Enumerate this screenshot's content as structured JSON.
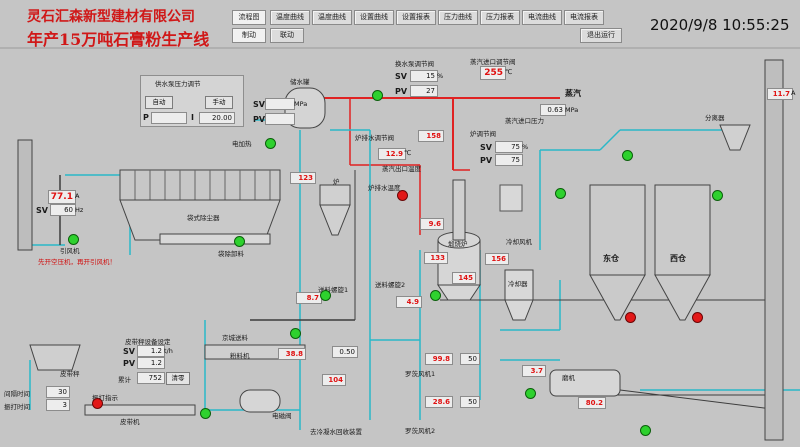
{
  "header": {
    "company": "灵石汇森新型建材有限公司",
    "line_title": "年产15万吨石膏粉生产线",
    "datetime": "2020/9/8 10:55:25"
  },
  "nav": {
    "row1": [
      "流程图",
      "温度曲线",
      "温度曲线",
      "设置曲线",
      "设置报表",
      "压力曲线",
      "压力报表",
      "电流曲线",
      "电流报表"
    ],
    "row2_left": [
      "制动",
      "联动"
    ],
    "logout": "退出运行"
  },
  "water_pressure": {
    "title": "供水泵压力调节",
    "btn_auto": "自动",
    "btn_manual": "手动",
    "sv_label": "SV",
    "pv_label": "PV",
    "p_label": "P",
    "i_label": "I",
    "sv": "",
    "pv": "",
    "p": "",
    "i": "20.00",
    "unit": "MPa"
  },
  "steam_pipe": {
    "label": "蒸汽",
    "pressure_label": "蒸汽进口压力",
    "pressure": "0.63",
    "unit": "MPa"
  },
  "steam_valve": {
    "title": "蒸汽进口调节阀",
    "sv": "",
    "pv": "",
    "sv2": "",
    "pv2": "",
    "temp": "255",
    "temp_unit": "℃"
  },
  "pump_valve": {
    "title": "换水泵调节阀",
    "sv": "15",
    "pv": "27",
    "unit": "%"
  },
  "separator": {
    "label": "分离器",
    "value": "11.7",
    "unit": "A"
  },
  "exhaust": {
    "fan_label": "引风机",
    "fan_value": "77.1",
    "fan_unit": "A",
    "sv_label": "SV",
    "sv": "60",
    "sv_unit": "Hz",
    "warning": "先开空压机，再开引风机！"
  },
  "baghouse": {
    "label": "袋式除尘器",
    "discharge": "袋除卸料",
    "heater": "电加热"
  },
  "furnace": {
    "label": "炉",
    "water_tank": "储水罐",
    "steam_outlet": "蒸汽出口温度",
    "steam_out_temp": "158",
    "outlet_valve": "炉排水调节阀",
    "outlet_temp": "12.9",
    "furnace_temp": "123",
    "exhaust_label": "炉排水温度",
    "temp_unit": "℃"
  },
  "calciner": {
    "label": "煅烧炉",
    "temp1": "9.6",
    "temp2": "133",
    "temp3": "145",
    "temp4": "156",
    "unit": "℃",
    "inlet_temp": "煅烧进口温度"
  },
  "cooler": {
    "label": "冷却器",
    "fan": "冷却风机",
    "temp": "15"
  },
  "valves_right": {
    "sv_label": "SV",
    "pv_label": "PV",
    "sv": "75",
    "pv": "75",
    "unit": "%",
    "title": "炉调节阀"
  },
  "silos": {
    "east": "东仓",
    "west": "西仓"
  },
  "screws": {
    "screw1": "送料螺旋1",
    "screw1_val": "8.7",
    "screw2": "送料螺旋2",
    "screw2_val": "4.9",
    "unit": "A"
  },
  "feed": {
    "title": "皮带秤设备设定",
    "sv_label": "SV",
    "pv_label": "PV",
    "sv": "1.2",
    "pv": "1.2",
    "unit": "t/h",
    "belt": "皮带秤",
    "crusher": "粉料机",
    "crusher_val": "38.8",
    "crusher_unit": "A",
    "mix": "京城送料",
    "reset": "清零",
    "total_label": "累计",
    "total": "752",
    "total_unit": "t"
  },
  "timers": {
    "interval_label": "间隔时间",
    "interval": "30",
    "vibrate_label": "振打时间",
    "vibrate": "3",
    "unit": "s",
    "vibrator": "振打指示",
    "belt_conveyor": "皮带机"
  },
  "bottom": {
    "motor1": "电磁阀",
    "return_label": "去冷凝水回收装置",
    "temp_bottom": "104",
    "temp_unit": "℃",
    "fan1": "罗茨风机1",
    "fan1_val": "99.8",
    "fan2": "罗茨风机2",
    "fan2_val": "28.6",
    "fan_unit": "A",
    "pct1": "50",
    "pct2": "50",
    "pct_unit": "%",
    "mill": "磨机",
    "mill_val": "80.2",
    "mill_unit": "A",
    "ball": "3.7",
    "ball_unit": "A",
    "pressure_valve": "0.50"
  }
}
